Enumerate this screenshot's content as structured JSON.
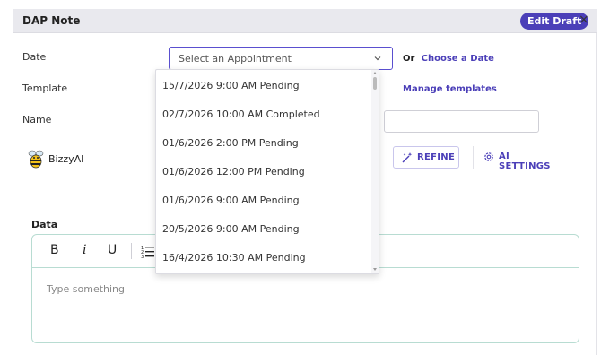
{
  "header": {
    "title": "DAP Note",
    "badge": "Edit Draft",
    "close": "×"
  },
  "form": {
    "date_label": "Date",
    "template_label": "Template",
    "name_label": "Name",
    "select_placeholder": "Select an Appointment",
    "or_text": "Or",
    "choose_date_link": "Choose a Date",
    "manage_templates_link": "Manage templates"
  },
  "ai": {
    "assistant_name": "BizzyAI",
    "refine_label": "REFINE",
    "settings_label": "AI SETTINGS"
  },
  "data_section": {
    "label": "Data",
    "toolbar": {
      "bold": "B",
      "italic": "i",
      "underline": "U"
    },
    "placeholder": "Type something"
  },
  "dropdown": {
    "items": [
      "15/7/2026 9:00 AM Pending",
      "02/7/2026 10:00 AM Completed",
      "01/6/2026 2:00 PM Pending",
      "01/6/2026 12:00 PM Pending",
      "01/6/2026 9:00 AM Pending",
      "20/5/2026 9:00 AM Pending",
      "16/4/2026 10:30 AM Pending"
    ]
  },
  "colors": {
    "accent": "#4b3fb8",
    "header_bg": "#e9e9ee",
    "editor_border": "#b8dcd2"
  }
}
